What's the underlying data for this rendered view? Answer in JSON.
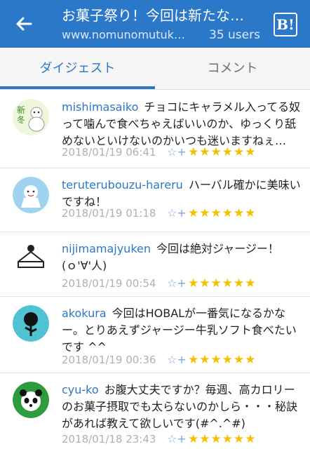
{
  "header": {
    "title": "お菓子祭り！今回は新たな…",
    "url": "www.nomunomutuk…",
    "users": "35 users",
    "hatena_label": "B!"
  },
  "tabs": [
    "ダイジェスト",
    "コメント"
  ],
  "comments": [
    {
      "user": "mishimasaiko",
      "text": "チョコにキャラメル入ってる奴って噛んで食べちゃえばいいのか、ゆっくり舐めないといけないのかいつも迷いますねぇ…",
      "date": "2018/01/19 06:41",
      "stars": "★★★★★★"
    },
    {
      "user": "teruterubouzu-hareru",
      "text": "ハーバル確かに美味いですね！",
      "date": "2018/01/19 01:18",
      "stars": "★★★★★★"
    },
    {
      "user": "nijimamajyuken",
      "text": "今回は絶対ジャージー！(ｏ'∀'人)",
      "date": "2018/01/19 00:54",
      "stars": "★★★★★★"
    },
    {
      "user": "akokura",
      "text": "今回はHOBALが一番気になるかなー。とりあえずジャージー牛乳ソフト食べたいです ^^",
      "date": "2018/01/19 00:36",
      "stars": "★★★★★★"
    },
    {
      "user": "cyu-ko",
      "text": "お腹大丈夫ですか？毎週、高カロリーのお菓子摂取でも太らないのかしら・・・秘訣があれば教えて欲しいです(#^.^#)",
      "date": "2018/01/18 23:43",
      "stars": "★★★★★★"
    }
  ],
  "add_star_icon": "☆+",
  "colors": {
    "brand": "#2b78c9",
    "star": "#f5c000"
  }
}
